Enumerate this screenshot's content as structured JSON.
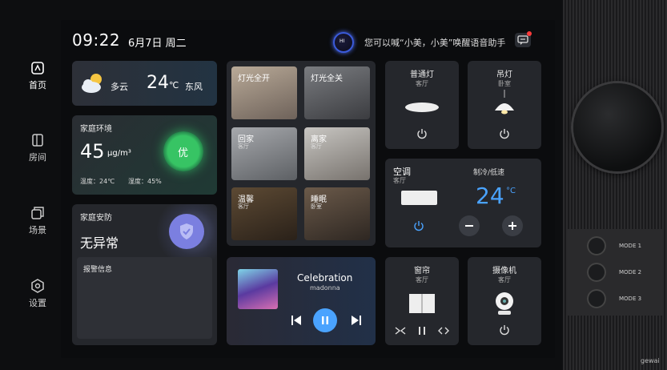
{
  "header": {
    "time": "09:22",
    "date": "6月7日 周二",
    "voice_hint": "您可以喊“小美，小美”唤醒语音助手",
    "voice_logo": "HI"
  },
  "nav": [
    {
      "label": "首页",
      "icon": "home-icon"
    },
    {
      "label": "房间",
      "icon": "door-icon"
    },
    {
      "label": "场景",
      "icon": "scene-icon"
    },
    {
      "label": "设置",
      "icon": "gear-icon"
    }
  ],
  "weather": {
    "condition": "多云",
    "temperature": "24",
    "unit": "℃",
    "wind": "东风"
  },
  "environment": {
    "title": "家庭环境",
    "value": "45",
    "unit": "μg/m³",
    "quality": "优",
    "temp_label": "温度：24℃",
    "humidity_label": "湿度：45%"
  },
  "security": {
    "title": "家庭安防",
    "status": "无异常",
    "alert_title": "报警信息"
  },
  "scenes": [
    {
      "name": "灯光全开",
      "room": ""
    },
    {
      "name": "灯光全关",
      "room": ""
    },
    {
      "name": "回家",
      "room": "客厅"
    },
    {
      "name": "离家",
      "room": "客厅"
    },
    {
      "name": "温馨",
      "room": "客厅"
    },
    {
      "name": "睡眠",
      "room": "卧室"
    }
  ],
  "music": {
    "title": "Celebration",
    "artist": "madonna"
  },
  "lights": [
    {
      "name": "普通灯",
      "room": "客厅"
    },
    {
      "name": "吊灯",
      "room": "卧室"
    }
  ],
  "ac": {
    "name": "空调",
    "room": "客厅",
    "mode": "制冷/低速",
    "temperature": "24",
    "unit": "°C"
  },
  "curtain": {
    "name": "窗帘",
    "room": "客厅"
  },
  "camera": {
    "name": "摄像机",
    "room": "客厅"
  },
  "modes": [
    "MODE 1",
    "MODE 2",
    "MODE 3"
  ],
  "brand": "gewai",
  "colors": {
    "accent": "#4aa3ff",
    "good": "#3ecf6a",
    "shield": "#7b7fe0"
  }
}
